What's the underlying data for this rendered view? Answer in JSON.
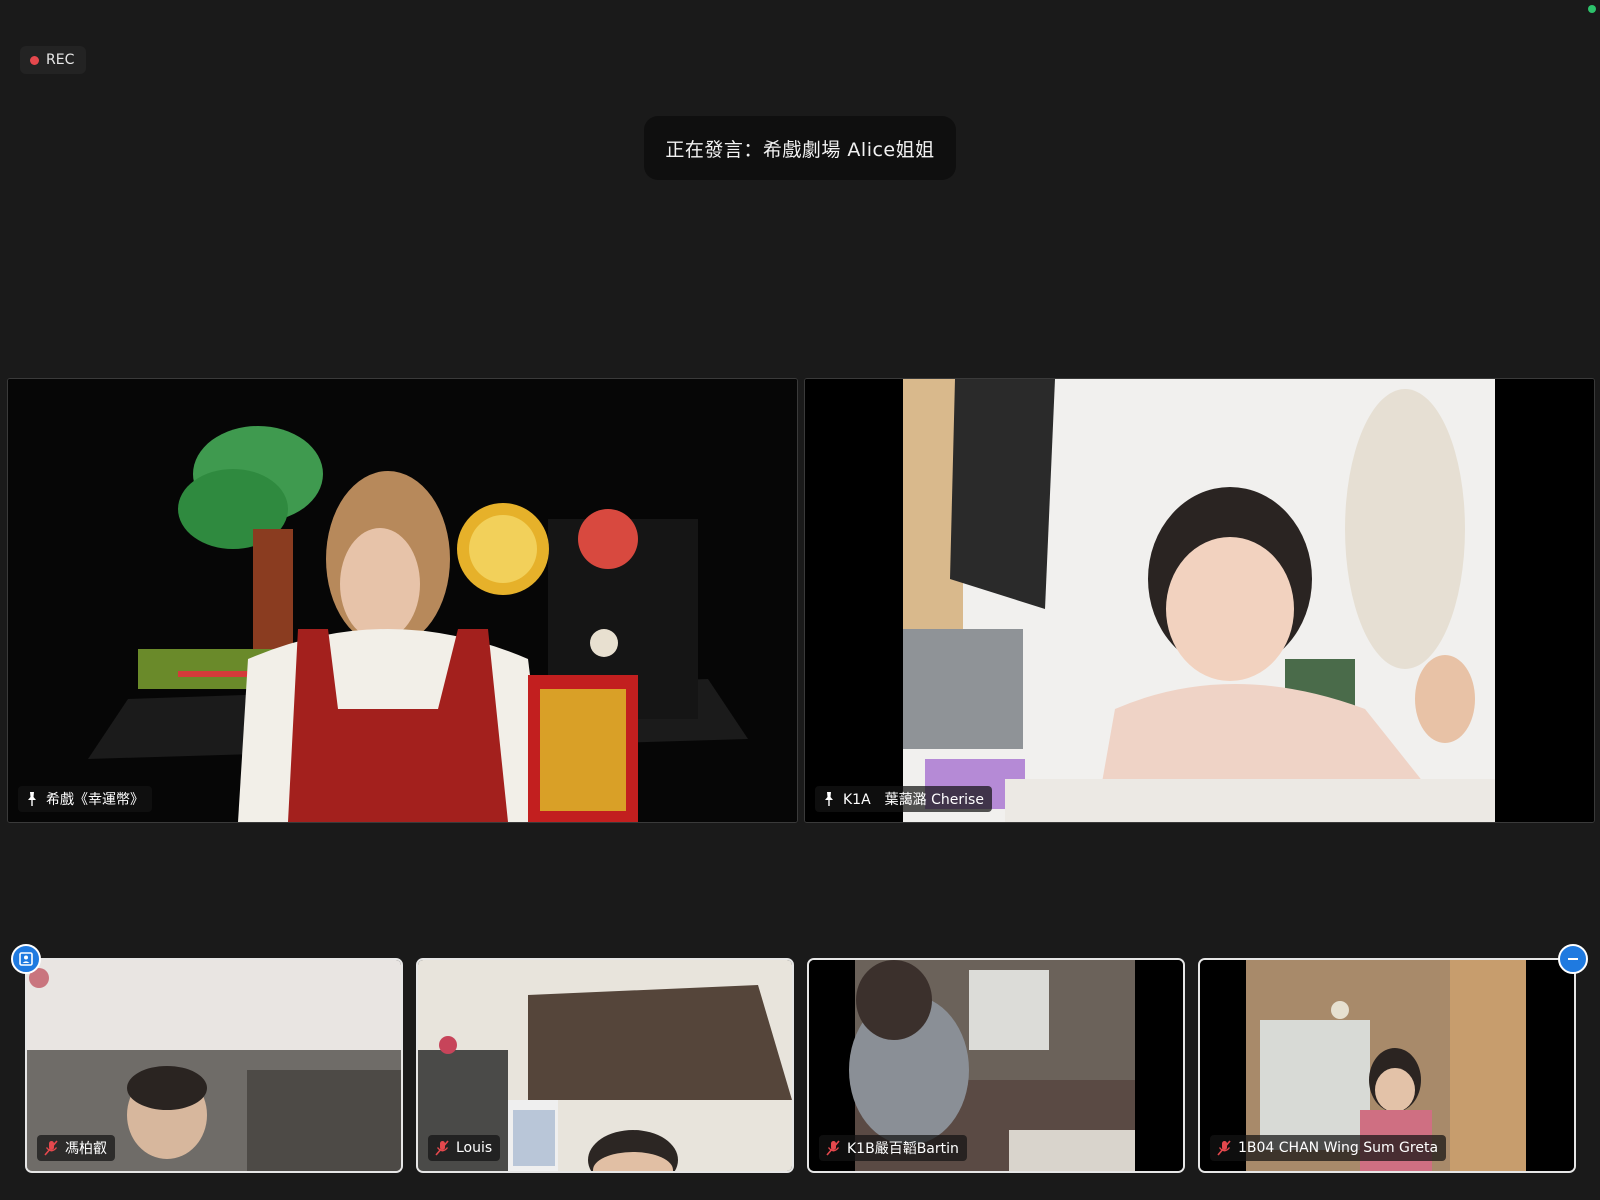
{
  "recording": {
    "label": "REC"
  },
  "active_speaker": {
    "text": "正在發言：希戲劇場 Alice姐姐"
  },
  "main_tiles": [
    {
      "name": "希戲《幸運幣》",
      "pinned": true
    },
    {
      "name": "K1A　葉藹潞 Cherise",
      "pinned": true
    }
  ],
  "thumbnails": [
    {
      "name": "馮柏叡",
      "muted": true
    },
    {
      "name": "Louis",
      "muted": true
    },
    {
      "name": "K1B嚴百韜Bartin",
      "muted": true
    },
    {
      "name": "1B04 CHAN Wing Sum Greta",
      "muted": true
    }
  ],
  "colors": {
    "background": "#1a1a1a",
    "rec_dot": "#e5484d",
    "accent": "#1f7ae0",
    "mute": "#e5484d"
  }
}
